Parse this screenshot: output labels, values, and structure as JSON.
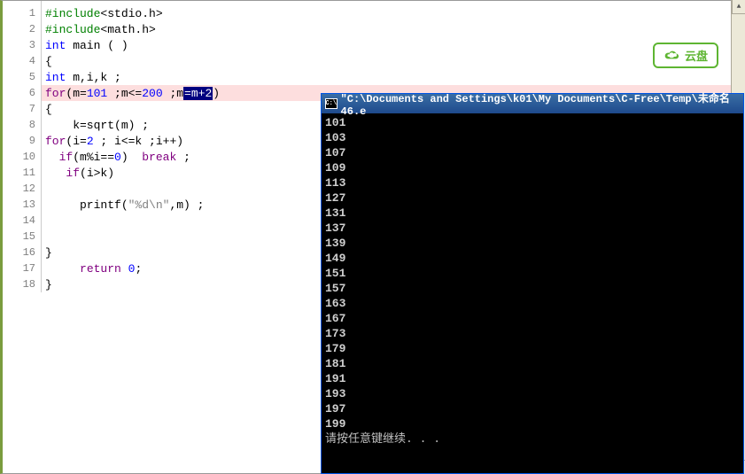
{
  "editor": {
    "lines": [
      {
        "num": "1",
        "tokens": [
          {
            "cls": "kw-green",
            "t": "#include"
          },
          {
            "cls": "plain",
            "t": "<stdio.h>"
          }
        ]
      },
      {
        "num": "2",
        "tokens": [
          {
            "cls": "kw-green",
            "t": "#include"
          },
          {
            "cls": "plain",
            "t": "<math.h>"
          }
        ]
      },
      {
        "num": "3",
        "tokens": [
          {
            "cls": "kw-blue",
            "t": "int"
          },
          {
            "cls": "plain",
            "t": " main ( )"
          }
        ]
      },
      {
        "num": "4",
        "tokens": [
          {
            "cls": "plain",
            "t": "{"
          }
        ]
      },
      {
        "num": "5",
        "tokens": [
          {
            "cls": "kw-blue",
            "t": "int"
          },
          {
            "cls": "plain",
            "t": " m,i,k ;"
          }
        ]
      },
      {
        "num": "6",
        "highlighted": true,
        "breakpoint": true,
        "tokens": [
          {
            "cls": "kw-purple",
            "t": "for"
          },
          {
            "cls": "plain",
            "t": "(m="
          },
          {
            "cls": "num-blue",
            "t": "101"
          },
          {
            "cls": "plain",
            "t": " ;m<="
          },
          {
            "cls": "num-blue",
            "t": "200"
          },
          {
            "cls": "plain",
            "t": " ;m"
          },
          {
            "cls": "selected",
            "t": "=m+2"
          },
          {
            "cls": "plain",
            "t": ")"
          }
        ]
      },
      {
        "num": "7",
        "tokens": [
          {
            "cls": "plain",
            "t": "{"
          }
        ]
      },
      {
        "num": "8",
        "tokens": [
          {
            "cls": "plain",
            "t": "    k=sqrt(m) ;"
          }
        ]
      },
      {
        "num": "9",
        "tokens": [
          {
            "cls": "kw-purple",
            "t": "for"
          },
          {
            "cls": "plain",
            "t": "(i="
          },
          {
            "cls": "num-blue",
            "t": "2"
          },
          {
            "cls": "plain",
            "t": " ; i<=k ;i++)"
          }
        ]
      },
      {
        "num": "10",
        "tokens": [
          {
            "cls": "plain",
            "t": "  "
          },
          {
            "cls": "kw-purple",
            "t": "if"
          },
          {
            "cls": "plain",
            "t": "(m%i=="
          },
          {
            "cls": "num-blue",
            "t": "0"
          },
          {
            "cls": "plain",
            "t": ")  "
          },
          {
            "cls": "kw-purple",
            "t": "break"
          },
          {
            "cls": "plain",
            "t": " ;"
          }
        ]
      },
      {
        "num": "11",
        "tokens": [
          {
            "cls": "plain",
            "t": "   "
          },
          {
            "cls": "kw-purple",
            "t": "if"
          },
          {
            "cls": "plain",
            "t": "(i>k)"
          }
        ]
      },
      {
        "num": "12",
        "tokens": [
          {
            "cls": "plain",
            "t": ""
          }
        ]
      },
      {
        "num": "13",
        "tokens": [
          {
            "cls": "plain",
            "t": "     printf("
          },
          {
            "cls": "str",
            "t": "\"%d\\n\""
          },
          {
            "cls": "plain",
            "t": ",m) ;"
          }
        ]
      },
      {
        "num": "14",
        "tokens": [
          {
            "cls": "plain",
            "t": ""
          }
        ]
      },
      {
        "num": "15",
        "tokens": [
          {
            "cls": "plain",
            "t": ""
          }
        ]
      },
      {
        "num": "16",
        "tokens": [
          {
            "cls": "plain",
            "t": "}"
          }
        ]
      },
      {
        "num": "17",
        "tokens": [
          {
            "cls": "plain",
            "t": "     "
          },
          {
            "cls": "kw-purple",
            "t": "return"
          },
          {
            "cls": "plain",
            "t": " "
          },
          {
            "cls": "num-blue",
            "t": "0"
          },
          {
            "cls": "plain",
            "t": ";"
          }
        ]
      },
      {
        "num": "18",
        "tokens": [
          {
            "cls": "plain",
            "t": "}"
          }
        ]
      }
    ]
  },
  "console": {
    "title_prefix": "\"C:\\Documents and Settings\\k01\\My Documents\\C-Free\\Temp\\未命名46.e",
    "icon_text": "C:\\",
    "output": [
      "101",
      "103",
      "107",
      "109",
      "113",
      "127",
      "131",
      "137",
      "139",
      "149",
      "151",
      "157",
      "163",
      "167",
      "173",
      "179",
      "181",
      "191",
      "193",
      "197",
      "199"
    ],
    "prompt": "请按任意键继续. . ."
  },
  "cloud_badge": {
    "label": "云盘"
  }
}
